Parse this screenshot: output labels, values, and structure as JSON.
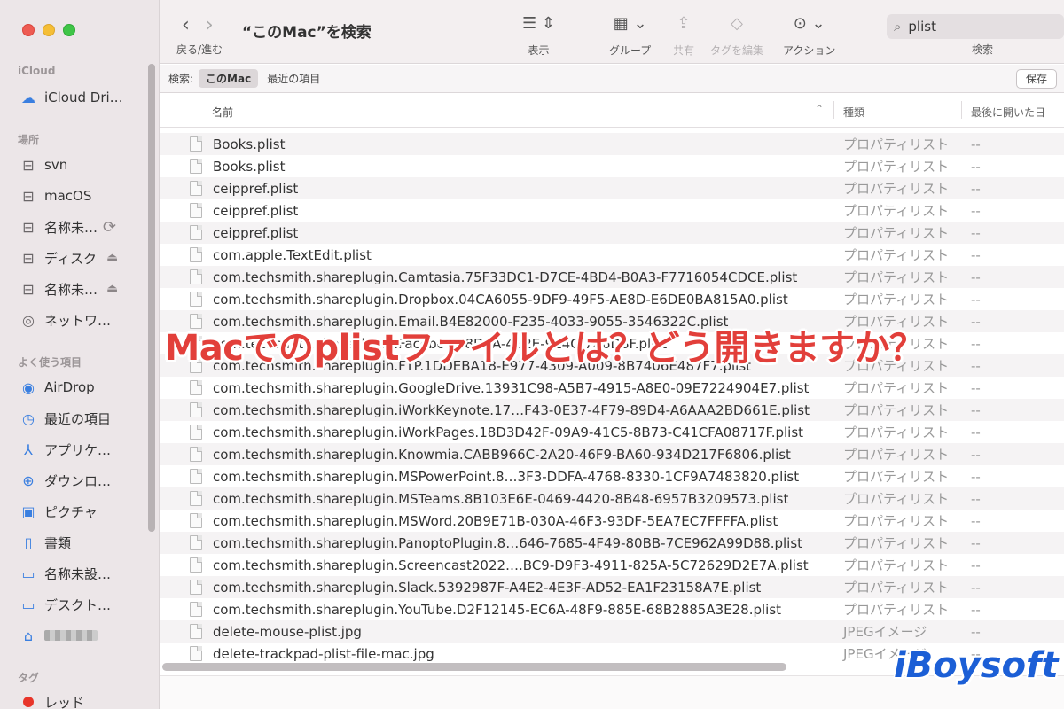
{
  "window": {
    "title": "“このMac”を検索",
    "nav_label": "戻る/進む"
  },
  "toolbar": {
    "view_label": "表示",
    "group_label": "グループ",
    "share_label": "共有",
    "tags_label": "タグを編集",
    "action_label": "アクション",
    "search_label": "検索",
    "search_value": "plist"
  },
  "scope": {
    "prefix": "検索:",
    "this_mac": "このMac",
    "recent": "最近の項目",
    "save": "保存"
  },
  "columns": {
    "name": "名前",
    "kind": "種類",
    "last_opened": "最後に開いた日"
  },
  "sidebar": {
    "icloud_header": "iCloud",
    "icloud_drive": "iCloud Dri…",
    "places_header": "場所",
    "places": [
      "svn",
      "macOS",
      "名称未…",
      "ディスク",
      "名称未…",
      "ネットワ…"
    ],
    "favorites_header": "よく使う項目",
    "favorites": [
      "AirDrop",
      "最近の項目",
      "アプリケ…",
      "ダウンロ…",
      "ピクチャ",
      "書類",
      "名称未設…",
      "デスクト…"
    ],
    "tags_header": "タグ",
    "tag_red": "レッド"
  },
  "files": [
    {
      "name": "Books.plist",
      "kind": "プロパティリスト",
      "date": "--"
    },
    {
      "name": "Books.plist",
      "kind": "プロパティリスト",
      "date": "--"
    },
    {
      "name": "ceippref.plist",
      "kind": "プロパティリスト",
      "date": "--"
    },
    {
      "name": "ceippref.plist",
      "kind": "プロパティリスト",
      "date": "--"
    },
    {
      "name": "ceippref.plist",
      "kind": "プロパティリスト",
      "date": "--"
    },
    {
      "name": "com.apple.TextEdit.plist",
      "kind": "プロパティリスト",
      "date": "--"
    },
    {
      "name": "com.techsmith.shareplugin.Camtasia.75F33DC1-D7CE-4BD4-B0A3-F7716054CDCE.plist",
      "kind": "プロパティリスト",
      "date": "--"
    },
    {
      "name": "com.techsmith.shareplugin.Dropbox.04CA6055-9DF9-49F5-AE8D-E6DE0BA815A0.plist",
      "kind": "プロパティリスト",
      "date": "--"
    },
    {
      "name": "com.techsmith.shareplugin.Email.B4E82000-F235-4033-9055-3546322C.plist",
      "kind": "プロパティリスト",
      "date": "--"
    },
    {
      "name": "com.techsmith.shareplugin.Facebook.8D7A-4B2E-9E4C-7A6D8F.plist",
      "kind": "プロパティリスト",
      "date": "--"
    },
    {
      "name": "com.techsmith.shareplugin.FTP.1DDEBA18-E977-4309-A009-8B7406E487F7.plist",
      "kind": "プロパティリスト",
      "date": "--"
    },
    {
      "name": "com.techsmith.shareplugin.GoogleDrive.13931C98-A5B7-4915-A8E0-09E7224904E7.plist",
      "kind": "プロパティリスト",
      "date": "--"
    },
    {
      "name": "com.techsmith.shareplugin.iWorkKeynote.17…F43-0E37-4F79-89D4-A6AAA2BD661E.plist",
      "kind": "プロパティリスト",
      "date": "--"
    },
    {
      "name": "com.techsmith.shareplugin.iWorkPages.18D3D42F-09A9-41C5-8B73-C41CFA08717F.plist",
      "kind": "プロパティリスト",
      "date": "--"
    },
    {
      "name": "com.techsmith.shareplugin.Knowmia.CABB966C-2A20-46F9-BA60-934D217F6806.plist",
      "kind": "プロパティリスト",
      "date": "--"
    },
    {
      "name": "com.techsmith.shareplugin.MSPowerPoint.8…3F3-DDFA-4768-8330-1CF9A7483820.plist",
      "kind": "プロパティリスト",
      "date": "--"
    },
    {
      "name": "com.techsmith.shareplugin.MSTeams.8B103E6E-0469-4420-8B48-6957B3209573.plist",
      "kind": "プロパティリスト",
      "date": "--"
    },
    {
      "name": "com.techsmith.shareplugin.MSWord.20B9E71B-030A-46F3-93DF-5EA7EC7FFFFA.plist",
      "kind": "プロパティリスト",
      "date": "--"
    },
    {
      "name": "com.techsmith.shareplugin.PanoptoPlugin.8…646-7685-4F49-80BB-7CE962A99D88.plist",
      "kind": "プロパティリスト",
      "date": "--"
    },
    {
      "name": "com.techsmith.shareplugin.Screencast2022….BC9-D9F3-4911-825A-5C72629D2E7A.plist",
      "kind": "プロパティリスト",
      "date": "--"
    },
    {
      "name": "com.techsmith.shareplugin.Slack.5392987F-A4E2-4E3F-AD52-EA1F23158A7E.plist",
      "kind": "プロパティリスト",
      "date": "--"
    },
    {
      "name": "com.techsmith.shareplugin.YouTube.D2F12145-EC6A-48F9-885E-68B2885A3E28.plist",
      "kind": "プロパティリスト",
      "date": "--"
    },
    {
      "name": "delete-mouse-plist.jpg",
      "kind": "JPEGイメージ",
      "date": "--"
    },
    {
      "name": "delete-trackpad-plist-file-mac.jpg",
      "kind": "JPEGイメージ",
      "date": "--"
    }
  ],
  "overlay": {
    "headline": "Macでのplistファイルとは？どう開きますか？",
    "brand": "iBoysoft"
  },
  "colors": {
    "headline": "#e23f3a",
    "brand": "#1c5fd6",
    "sidebar_bg": "#ece6e8",
    "accent": "#3a7fe0"
  }
}
